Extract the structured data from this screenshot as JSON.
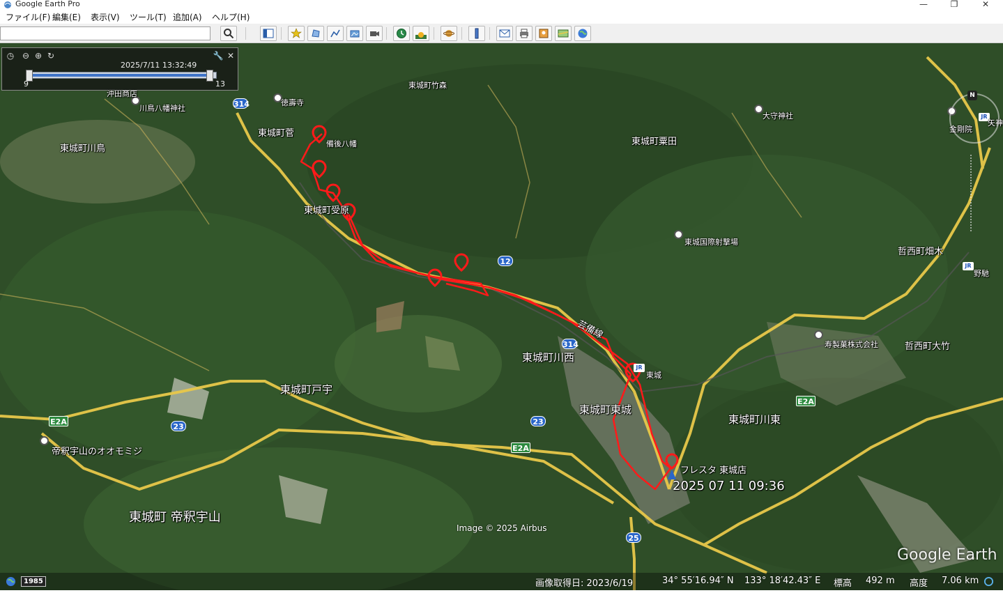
{
  "window": {
    "title": "Google Earth Pro",
    "controls": {
      "minimize": "—",
      "maximize": "❐",
      "close": "✕"
    }
  },
  "menu": [
    "ファイル(F)",
    "編集(E)",
    "表示(V)",
    "ツール(T)",
    "追加(A)",
    "ヘルプ(H)"
  ],
  "search": {
    "value": "",
    "placeholder": ""
  },
  "time_slider": {
    "date_label": "2025/7/11  13:32:49",
    "min_label": "9",
    "max_label": "13",
    "position_fraction": 0.97
  },
  "map_labels": {
    "higashijo_takemori": "東城町竹森",
    "tokujuji": "徳壽寺",
    "kawatori_hachiman": "川鳥八幡神社",
    "okita_shoten": "沖田商店",
    "higashijo_suge": "東城町菅",
    "bingo_hachiman": "備後八幡",
    "higashijo_kawatori": "東城町川鳥",
    "higashijo_kurita": "東城町粟田",
    "daishi_jinja": "大守神社",
    "higashijo_ukebara": "東城町受原",
    "higashijo_shooting": "東城国際射撃場",
    "geibi_line": "芸備線",
    "jr_yagami": "矢神",
    "kongoin": "金剛院",
    "tetta_hatagi": "哲西町畑木",
    "nose": "野馳",
    "kotobuki_seika": "寿製菓株式会社",
    "tetta_otake": "哲西町大竹",
    "higashijo_kawanishi": "東城町川西",
    "tojo_station": "東城",
    "higashijo_higashijo": "東城町東城",
    "higashijo_tou": "東城町戸宇",
    "higashijo_kawahigashi": "東城町川東",
    "taishakukyo_omomiji": "帝釈宇山のオオモミジ",
    "fresta_tojo": "フレスタ 東城店",
    "timestamp": "2025 07 11 09:36",
    "higashijo_taishaku_uyama": "東城町 帝釈宇山"
  },
  "route_shields": {
    "r314_top": "314",
    "r12": "12",
    "r314_mid": "314",
    "e2a_left": "E2A",
    "r23_left": "23",
    "r23_mid": "23",
    "e2a_mid": "E2A",
    "e2a_right": "E2A",
    "r25": "25"
  },
  "attribution": "Image © 2025 Airbus",
  "logo": "Google Earth",
  "nav": {
    "north": "N"
  },
  "status": {
    "year": "1985",
    "capture_date": "画像取得日: 2023/6/19",
    "lat": "34° 55′16.94″ N",
    "lon": "133° 18′42.43″ E",
    "elev_label": "標高",
    "elev_value": "492 m",
    "alt_label": "高度",
    "alt_value": "7.06 km"
  },
  "colors": {
    "track": "#ff1a1a",
    "road": "#e8c84a",
    "forest": "#2d4a26"
  }
}
